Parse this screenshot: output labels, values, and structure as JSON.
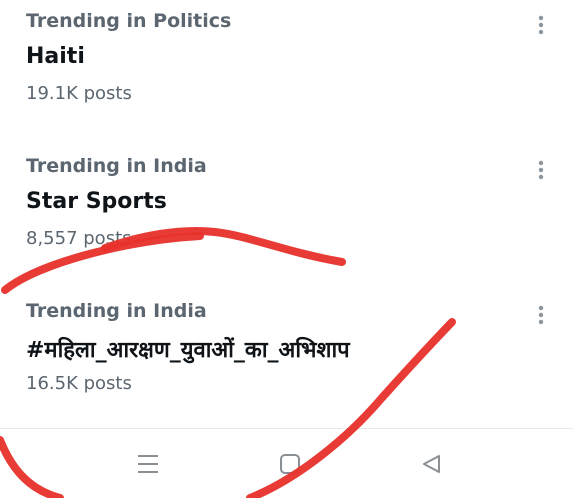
{
  "trends": [
    {
      "context": "Trending in Politics",
      "name": "Haiti",
      "count": "19.1K posts"
    },
    {
      "context": "Trending in India",
      "name": "Star Sports",
      "count": "8,557 posts"
    },
    {
      "context": "Trending in India",
      "name": "#महिला_आरक्षण_युवाओं_का_अभिशाप",
      "count": "16.5K posts"
    }
  ],
  "icons": {
    "more": "more-vertical-icon",
    "recents": "recents-icon",
    "home": "home-icon",
    "back": "back-icon"
  },
  "colors": {
    "scribble": "#e8302b",
    "secondary_text": "#5b6670",
    "primary_text": "#0f1419"
  }
}
